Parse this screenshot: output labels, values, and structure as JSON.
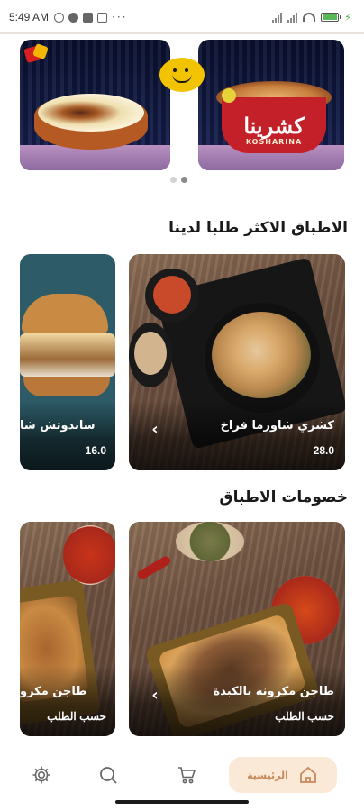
{
  "status_bar": {
    "time": "5:49 AM",
    "indicators": "···",
    "battery_charging": true
  },
  "hero": {
    "left_card": "dessert-bowl-image",
    "right_card": "koshari-cup-image",
    "cup_brand": "كشرينا",
    "cup_subtitle": "KOSHARINA",
    "slides": 2,
    "active_slide": 2
  },
  "sections": {
    "top_ordered": {
      "title": "الاطباق الاكثر طلبا لدينا",
      "items": [
        {
          "name": "كشري شاورما فراخ",
          "price": "28.0"
        },
        {
          "name": "ساندوتش شا",
          "price": "16.0"
        }
      ]
    },
    "discounts": {
      "title": "خصومات الاطباق",
      "items": [
        {
          "name": "طاجن مكرونه بالكبدة",
          "price": "حسب الطلب"
        },
        {
          "name": "طاجن مكرو",
          "price": "حسب الطلب"
        }
      ]
    }
  },
  "bottom_nav": {
    "items": [
      {
        "name": "settings",
        "icon": "gear-icon"
      },
      {
        "name": "search",
        "icon": "search-icon"
      },
      {
        "name": "cart",
        "icon": "cart-icon"
      },
      {
        "name": "home",
        "icon": "home-icon",
        "label": "الرئيسية",
        "active": true
      }
    ]
  },
  "colors": {
    "accent": "#c8895a",
    "active_tab_bg": "#fbe9d8",
    "battery": "#58b957"
  }
}
